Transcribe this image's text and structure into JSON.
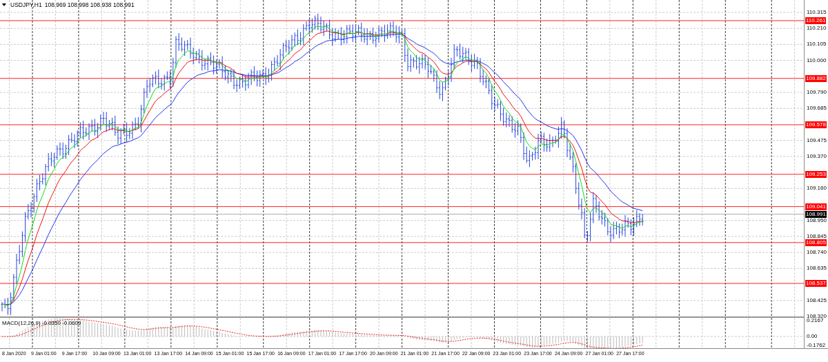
{
  "header": {
    "symbol": "USDJPY,H1",
    "quote": "108.969 108.998 108.938 108.991"
  },
  "price_axis": [
    {
      "label": "110.315",
      "kind": "tick"
    },
    {
      "label": "110.261",
      "kind": "level"
    },
    {
      "label": "110.210",
      "kind": "tick"
    },
    {
      "label": "110.105",
      "kind": "tick"
    },
    {
      "label": "110.000",
      "kind": "tick"
    },
    {
      "label": "109.882",
      "kind": "level"
    },
    {
      "label": "109.790",
      "kind": "tick"
    },
    {
      "label": "109.685",
      "kind": "tick"
    },
    {
      "label": "109.578",
      "kind": "level"
    },
    {
      "label": "109.475",
      "kind": "tick"
    },
    {
      "label": "109.370",
      "kind": "tick"
    },
    {
      "label": "109.253",
      "kind": "level"
    },
    {
      "label": "109.160",
      "kind": "tick"
    },
    {
      "label": "109.041",
      "kind": "level"
    },
    {
      "label": "108.991",
      "kind": "current"
    },
    {
      "label": "108.950",
      "kind": "tick"
    },
    {
      "label": "108.845",
      "kind": "tick"
    },
    {
      "label": "108.805",
      "kind": "level"
    },
    {
      "label": "108.740",
      "kind": "tick"
    },
    {
      "label": "108.635",
      "kind": "tick"
    },
    {
      "label": "108.537",
      "kind": "level"
    },
    {
      "label": "108.425",
      "kind": "tick"
    },
    {
      "label": "108.320",
      "kind": "tick"
    }
  ],
  "indicator": {
    "label": "MACD(12,26,9) -0.0350 -0.0609",
    "axis": [
      "0.2167",
      "0.00",
      "-0.1762"
    ]
  },
  "time_axis": [
    "8 Jan 2020",
    "9 Jan 01:00",
    "9 Jan 17:00",
    "10 Jan 09:00",
    "13 Jan 01:00",
    "13 Jan 17:00",
    "14 Jan 09:00",
    "15 Jan 01:00",
    "15 Jan 17:00",
    "16 Jan 09:00",
    "17 Jan 01:00",
    "17 Jan 17:00",
    "20 Jan 09:00",
    "21 Jan 01:00",
    "21 Jan 17:00",
    "22 Jan 09:00",
    "23 Jan 01:00",
    "23 Jan 17:00",
    "24 Jan 09:00",
    "27 Jan 01:00",
    "27 Jan 17:00"
  ]
}
